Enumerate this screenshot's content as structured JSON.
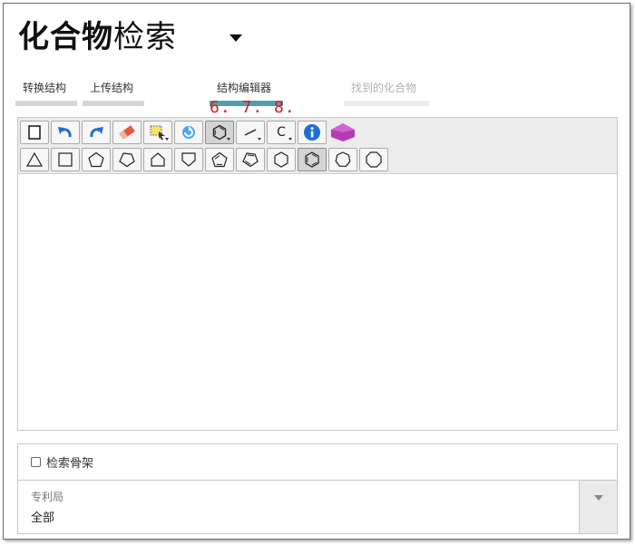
{
  "header": {
    "title_bold": "化合物",
    "title_light": "检索"
  },
  "tabs": [
    {
      "label": "转换结构",
      "state": "normal"
    },
    {
      "label": "上传结构",
      "state": "normal"
    },
    {
      "label": "结构编辑器",
      "state": "active"
    },
    {
      "label": "找到的化合物",
      "state": "disabled"
    }
  ],
  "annotation": {
    "step_numbers": "6. 7. 8."
  },
  "toolbar": {
    "row1": [
      "clear-icon",
      "undo-icon",
      "redo-icon",
      "eraser-icon",
      "select-icon",
      "rotate-icon",
      "ring-template-icon",
      "bond-icon",
      "atom-icon",
      "info-icon",
      "infochem-logo-icon"
    ],
    "atom_label": "C",
    "row2": [
      "triangle-icon",
      "square-icon",
      "pentagon-icon",
      "pentagon-rotated-icon",
      "pentagon-house-icon",
      "pentagon-inverted-icon",
      "cyclopentadiene-icon",
      "cyclopentadiene-alt-icon",
      "hexagon-icon",
      "benzene-icon",
      "heptagon-icon",
      "octagon-icon"
    ],
    "pressed_row1": "ring-template-icon",
    "pressed_row2": "benzene-icon"
  },
  "options": {
    "scaffold_label": "检索骨架",
    "scaffold_checked": false,
    "office_label": "专利局",
    "office_value": "全部"
  },
  "colors": {
    "active_tab": "#4f9fae",
    "annotation": "#e0191b",
    "undo_redo": "#1f6fd1"
  }
}
